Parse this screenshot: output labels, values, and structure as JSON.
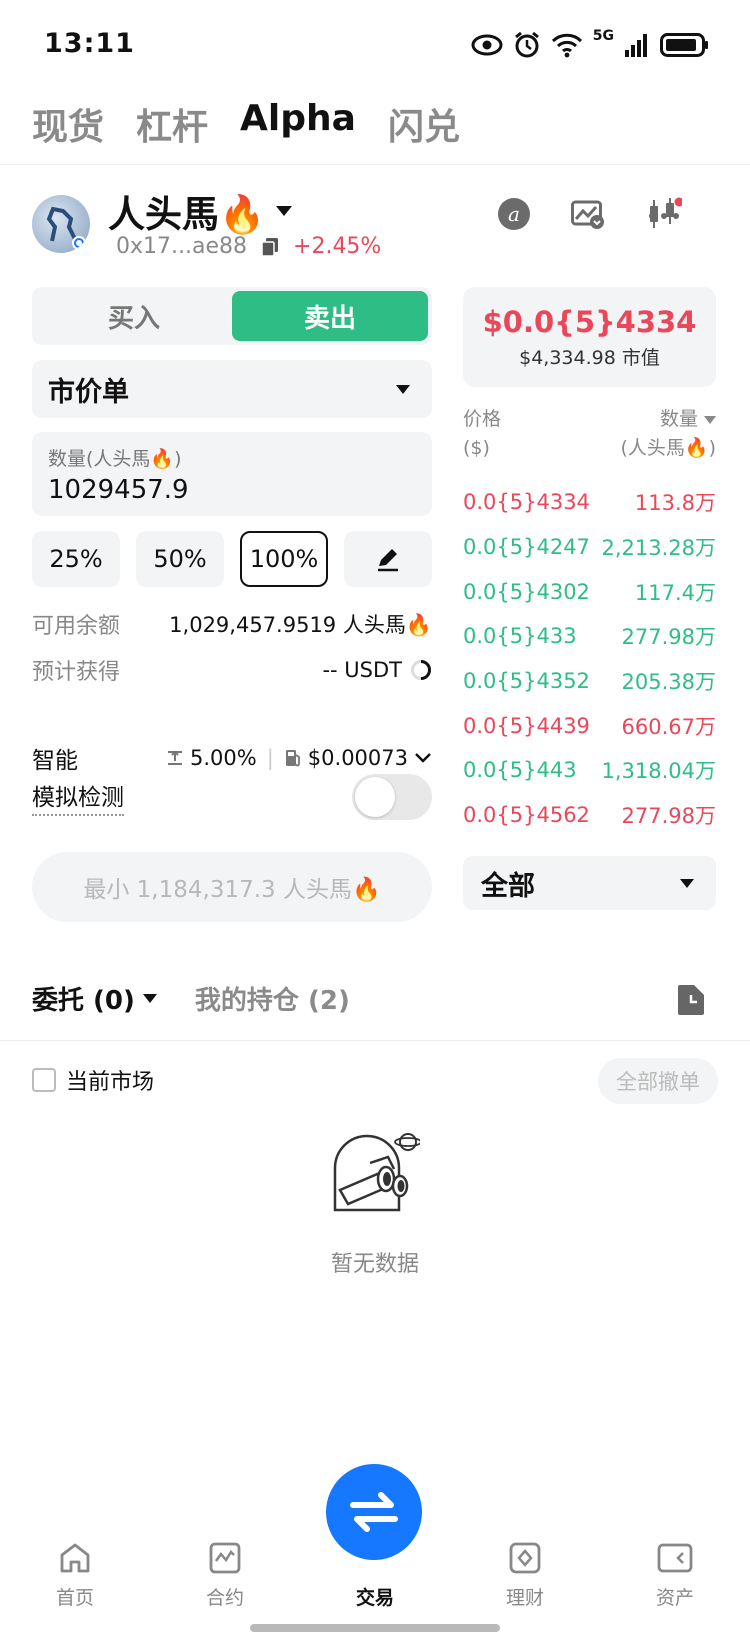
{
  "status_bar": {
    "time": "13:11",
    "network": "5G"
  },
  "top_tabs": [
    "现货",
    "杠杆",
    "Alpha",
    "闪兑"
  ],
  "token": {
    "name": "人头馬🔥",
    "address": "0x17...ae88",
    "change": "+2.45%"
  },
  "trade": {
    "buy_label": "买入",
    "sell_label": "卖出",
    "order_type": "市价单",
    "qty_label": "数量(人头馬🔥)",
    "qty_value": "1029457.9",
    "percents": [
      "25%",
      "50%",
      "100%"
    ],
    "available_label": "可用余额",
    "available_value": "1,029,457.9519 人头馬🔥",
    "estimate_label": "预计获得",
    "estimate_value": "-- USDT",
    "smart_label": "智能",
    "slippage": "5.00%",
    "gas": "$0.00073",
    "simulate_label": "模拟检测",
    "submit_label": "最小 1,184,317.3 人头馬🔥"
  },
  "price_card": {
    "price": "$0.0{5}4334",
    "market_cap": "$4,334.98 市值"
  },
  "orderbook": {
    "price_header": "价格",
    "price_unit": "($)",
    "qty_header": "数量",
    "qty_unit": "(人头馬🔥)",
    "rows": [
      {
        "price": "0.0{5}4334",
        "qty": "113.8万",
        "side": "red"
      },
      {
        "price": "0.0{5}4247",
        "qty": "2,213.28万",
        "side": "green"
      },
      {
        "price": "0.0{5}4302",
        "qty": "117.4万",
        "side": "green"
      },
      {
        "price": "0.0{5}433",
        "qty": "277.98万",
        "side": "green"
      },
      {
        "price": "0.0{5}4352",
        "qty": "205.38万",
        "side": "green"
      },
      {
        "price": "0.0{5}4439",
        "qty": "660.67万",
        "side": "red"
      },
      {
        "price": "0.0{5}443",
        "qty": "1,318.04万",
        "side": "green"
      },
      {
        "price": "0.0{5}4562",
        "qty": "277.98万",
        "side": "red"
      }
    ],
    "filter": "全部"
  },
  "orders": {
    "tab_orders": "委托 (0)",
    "tab_positions": "我的持仓 (2)",
    "current_market": "当前市场",
    "cancel_all": "全部撤单",
    "empty": "暂无数据"
  },
  "bottom_nav": [
    {
      "label": "首页",
      "icon": "home-icon"
    },
    {
      "label": "合约",
      "icon": "contract-icon"
    },
    {
      "label": "交易",
      "icon": "trade-swap-icon"
    },
    {
      "label": "理财",
      "icon": "finance-icon"
    },
    {
      "label": "资产",
      "icon": "wallet-icon"
    }
  ],
  "colors": {
    "buy": "#2ebd85",
    "sell": "#e8485a",
    "primary": "#1677ff"
  }
}
